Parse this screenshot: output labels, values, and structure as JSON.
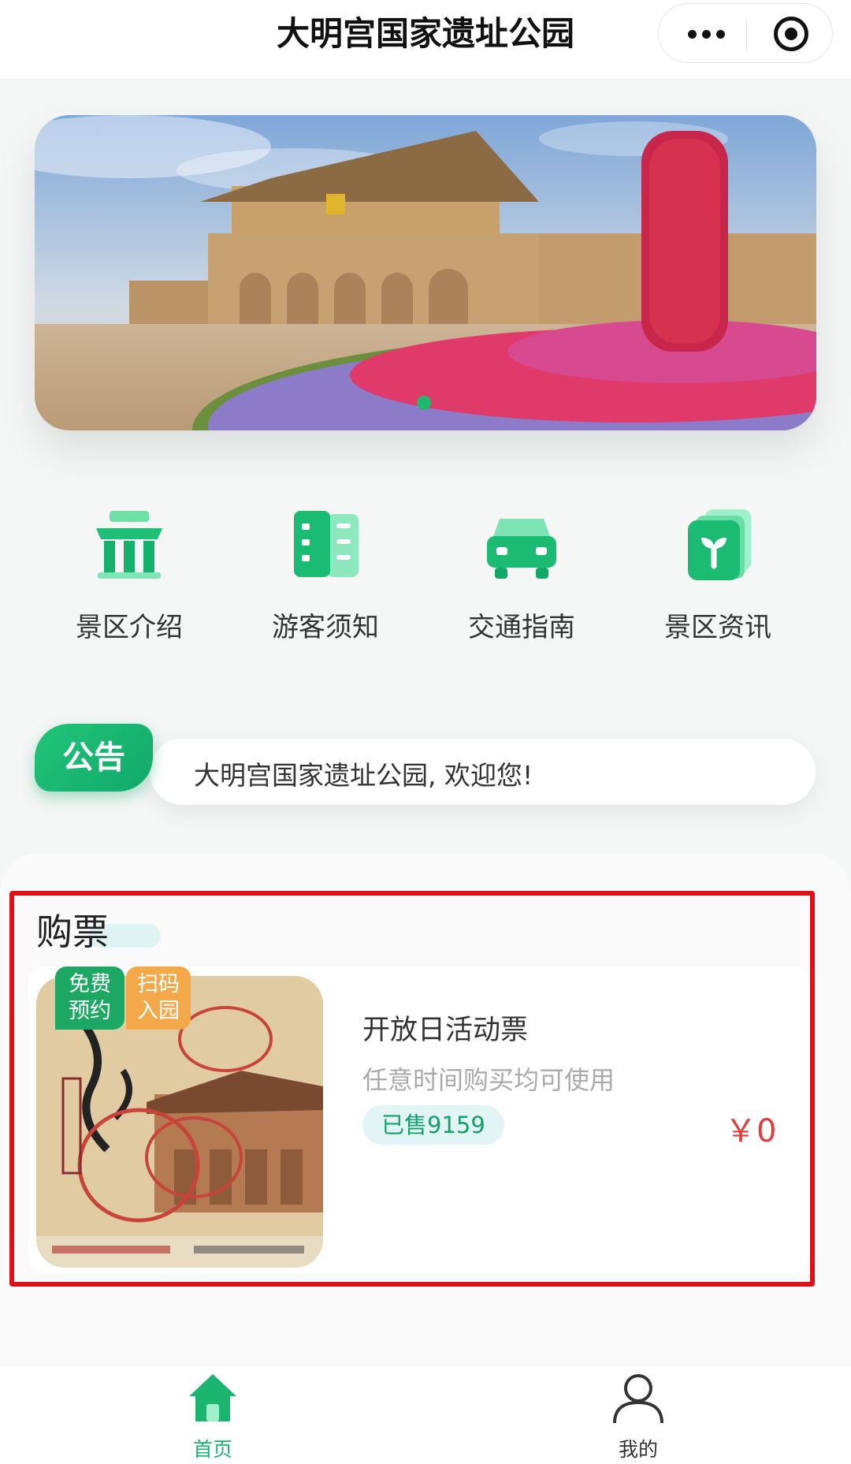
{
  "header": {
    "title": "大明宫国家遗址公园",
    "more_icon": "more-dots-icon",
    "close_icon": "target-circle-icon"
  },
  "banner": {
    "active_slide": 1,
    "slide_count": 1
  },
  "quick_nav": [
    {
      "label": "景区介绍",
      "icon": "pavilion-icon"
    },
    {
      "label": "游客须知",
      "icon": "book-icon"
    },
    {
      "label": "交通指南",
      "icon": "car-icon"
    },
    {
      "label": "景区资讯",
      "icon": "sprout-card-icon"
    }
  ],
  "notice": {
    "badge": "公告",
    "text": "大明宫国家遗址公园, 欢迎您!"
  },
  "tickets": {
    "section_title": "购票",
    "items": [
      {
        "tag_free": "免费预约",
        "tag_free_line1": "免费",
        "tag_free_line2": "预约",
        "tag_scan_line1": "扫码",
        "tag_scan_line2": "入园",
        "name": "开放日活动票",
        "description": "任意时间购买均可使用",
        "sold": "已售9159",
        "price": "￥0"
      }
    ]
  },
  "tabbar": [
    {
      "label": "首页",
      "icon": "home-icon",
      "active": true
    },
    {
      "label": "我的",
      "icon": "user-icon",
      "active": false
    }
  ],
  "colors": {
    "accent": "#1fb66e",
    "price": "#e23b3b",
    "highlight_frame": "#e0101b"
  }
}
